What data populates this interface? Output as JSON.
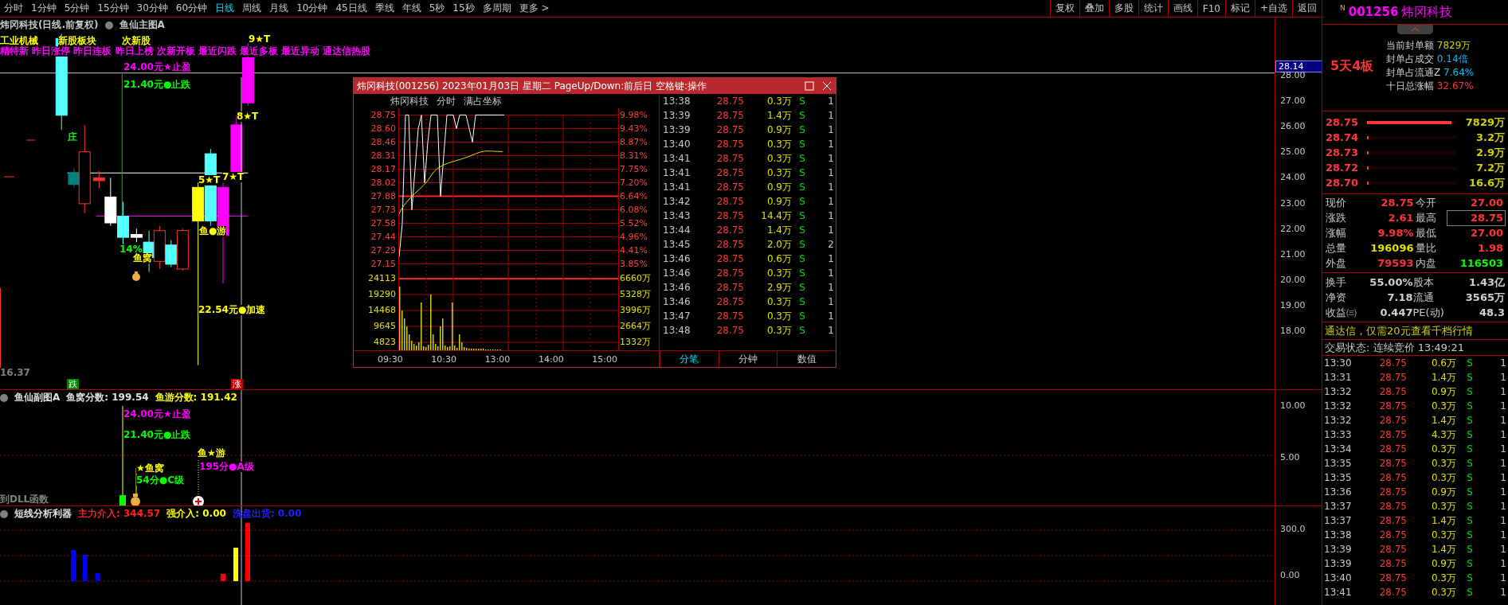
{
  "toolbar": {
    "periods": [
      {
        "label": "分时",
        "selected": false
      },
      {
        "label": "1分钟",
        "selected": false
      },
      {
        "label": "5分钟",
        "selected": false
      },
      {
        "label": "15分钟",
        "selected": false
      },
      {
        "label": "30分钟",
        "selected": false
      },
      {
        "label": "60分钟",
        "selected": false
      },
      {
        "label": "日线",
        "selected": true
      },
      {
        "label": "周线",
        "selected": false
      },
      {
        "label": "月线",
        "selected": false
      },
      {
        "label": "10分钟",
        "selected": false
      },
      {
        "label": "45日线",
        "selected": false
      },
      {
        "label": "季线",
        "selected": false
      },
      {
        "label": "年线",
        "selected": false
      },
      {
        "label": "5秒",
        "selected": false
      },
      {
        "label": "15秒",
        "selected": false
      },
      {
        "label": "多周期",
        "selected": false
      },
      {
        "label": "更多 >",
        "selected": false
      }
    ],
    "actions": [
      "复权",
      "叠加",
      "多股",
      "统计",
      "画线",
      "F10",
      "标记",
      "+自选",
      "返回"
    ]
  },
  "main_chart": {
    "title": "炜冈科技(日线.前复权)",
    "indicator": "鱼仙主图A",
    "labels": [
      {
        "text": "工业机械",
        "color": "#ffff00"
      },
      {
        "text": "新股板块",
        "color": "#ffff00"
      },
      {
        "text": "次新股",
        "color": "#ffff00"
      },
      {
        "text": "精特新 昨日涨停 昨日连板 昨日上榜 次新开板 最近闪跌 最近多板 最近异动 通达信热股",
        "color": "#ff00ff"
      },
      {
        "text": "9★T",
        "color": "#ffff00"
      },
      {
        "text": "24.00元★止盈",
        "color": "#ff00ff"
      },
      {
        "text": "21.40元●止跌",
        "color": "#00ff00"
      },
      {
        "text": "8★T",
        "color": "#ffff00"
      },
      {
        "text": "5★T",
        "color": "#ffff00"
      },
      {
        "text": "7★T",
        "color": "#ffff00"
      },
      {
        "text": "庄",
        "color": "#00ff00"
      },
      {
        "text": "14%",
        "color": "#00ff00"
      },
      {
        "text": "鱼窝",
        "color": "#ffff00"
      },
      {
        "text": "鱼●游",
        "color": "#ffff00"
      },
      {
        "text": "22.54元●加速",
        "color": "#ffff00"
      },
      {
        "text": "16.37",
        "color": "#808080"
      }
    ],
    "markers": [
      {
        "text": "跌",
        "color": "#008000"
      },
      {
        "text": "涨",
        "color": "#c00000"
      }
    ],
    "axis": [
      "28.00",
      "27.00",
      "26.00",
      "25.00",
      "24.00",
      "23.00",
      "22.00",
      "21.00",
      "20.00",
      "19.00",
      "18.00"
    ],
    "current_price": "28.14"
  },
  "sub_chart": {
    "readings": [
      {
        "text": "鱼仙副图A",
        "color": "#e0e0e0"
      },
      {
        "text": "鱼窝分数: 199.54",
        "color": "#e0e0e0"
      },
      {
        "text": "鱼游分数: 191.42",
        "color": "#ffff00"
      }
    ],
    "labels": [
      {
        "text": "24.00元★止盈",
        "color": "#ff00ff"
      },
      {
        "text": "21.40元●止跌",
        "color": "#00ff00"
      },
      {
        "text": "★鱼窝",
        "color": "#ffff00"
      },
      {
        "text": "54分●C级",
        "color": "#00ff00"
      },
      {
        "text": "鱼★游",
        "color": "#ffff00"
      },
      {
        "text": "195分●A级",
        "color": "#ff00ff"
      },
      {
        "text": "到DLL函数",
        "color": "#808080"
      }
    ],
    "axis": [
      "10.00",
      "5.00"
    ]
  },
  "bottom_chart": {
    "readings": [
      {
        "text": "短线分析利器",
        "color": "#e0e0e0"
      },
      {
        "text": "主力介入: 344.57",
        "color": "#ff2020"
      },
      {
        "text": "强介入: 0.00",
        "color": "#ffff00"
      },
      {
        "text": "洗盘出货: 0.00",
        "color": "#2020ff"
      }
    ],
    "axis": [
      "300.0",
      "0.00"
    ]
  },
  "popup": {
    "title": "炜冈科技(001256) 2023年01月03日 星期二 PageUp/Down:前后日 空格键:操作",
    "header": [
      "炜冈科技",
      "分时",
      "满占坐标"
    ],
    "prices": [
      "28.75",
      "28.60",
      "28.46",
      "28.31",
      "28.17",
      "28.02",
      "27.88",
      "27.73",
      "27.58",
      "27.44",
      "27.29",
      "27.15"
    ],
    "percents": [
      "9.98%",
      "9.43%",
      "8.87%",
      "8.31%",
      "7.75%",
      "7.20%",
      "6.64%",
      "6.08%",
      "5.52%",
      "4.96%",
      "4.41%",
      "3.85%"
    ],
    "volumes": [
      "24113",
      "19290",
      "14468",
      "9645",
      "4823"
    ],
    "amounts": [
      "6660万",
      "5328万",
      "3996万",
      "2664万",
      "1332万"
    ],
    "times": [
      "09:30",
      "10:30",
      "13:00",
      "14:00",
      "15:00"
    ],
    "ticks": [
      {
        "time": "13:38",
        "price": "28.75",
        "volume": "0.3万",
        "side": "S",
        "count": "1"
      },
      {
        "time": "13:39",
        "price": "28.75",
        "volume": "1.4万",
        "side": "S",
        "count": "1"
      },
      {
        "time": "13:39",
        "price": "28.75",
        "volume": "0.9万",
        "side": "S",
        "count": "1"
      },
      {
        "time": "13:40",
        "price": "28.75",
        "volume": "0.3万",
        "side": "S",
        "count": "1"
      },
      {
        "time": "13:41",
        "price": "28.75",
        "volume": "0.3万",
        "side": "S",
        "count": "1"
      },
      {
        "time": "13:41",
        "price": "28.75",
        "volume": "0.3万",
        "side": "S",
        "count": "1"
      },
      {
        "time": "13:41",
        "price": "28.75",
        "volume": "0.9万",
        "side": "S",
        "count": "1"
      },
      {
        "time": "13:42",
        "price": "28.75",
        "volume": "0.9万",
        "side": "S",
        "count": "1"
      },
      {
        "time": "13:43",
        "price": "28.75",
        "volume": "14.4万",
        "side": "S",
        "count": "1"
      },
      {
        "time": "13:44",
        "price": "28.75",
        "volume": "1.4万",
        "side": "S",
        "count": "1"
      },
      {
        "time": "13:45",
        "price": "28.75",
        "volume": "2.0万",
        "side": "S",
        "count": "2"
      },
      {
        "time": "13:46",
        "price": "28.75",
        "volume": "0.6万",
        "side": "S",
        "count": "1"
      },
      {
        "time": "13:46",
        "price": "28.75",
        "volume": "0.3万",
        "side": "S",
        "count": "1"
      },
      {
        "time": "13:46",
        "price": "28.75",
        "volume": "2.9万",
        "side": "S",
        "count": "1"
      },
      {
        "time": "13:46",
        "price": "28.75",
        "volume": "0.3万",
        "side": "S",
        "count": "1"
      },
      {
        "time": "13:47",
        "price": "28.75",
        "volume": "0.3万",
        "side": "S",
        "count": "1"
      },
      {
        "time": "13:48",
        "price": "28.75",
        "volume": "0.3万",
        "side": "S",
        "count": "1"
      }
    ],
    "tabs": [
      {
        "label": "分笔",
        "selected": true
      },
      {
        "label": "分钟",
        "selected": false
      },
      {
        "label": "数值",
        "selected": false
      }
    ]
  },
  "quote_panel": {
    "badge": "N",
    "code": "001256",
    "name": "炜冈科技",
    "board": "5天4板",
    "seal_info": [
      {
        "label": "当前封单额",
        "value": "7829万",
        "color": "#d0d000"
      },
      {
        "label": "封单占成交",
        "value": "0.14倍",
        "color": "#00c0ff"
      },
      {
        "label": "封单占流通Z",
        "value": "7.64%",
        "color": "#00c0ff"
      },
      {
        "label": "十日总涨幅",
        "value": "32.67%",
        "color": "#ff3333"
      }
    ],
    "order_book": [
      {
        "price": "28.75",
        "volume": "7829万",
        "level": 0.95
      },
      {
        "price": "28.74",
        "volume": "3.2万",
        "level": 0.02
      },
      {
        "price": "28.73",
        "volume": "2.9万",
        "level": 0.02
      },
      {
        "price": "28.72",
        "volume": "7.2万",
        "level": 0.02
      },
      {
        "price": "28.70",
        "volume": "16.6万",
        "level": 0.02
      }
    ],
    "quote": [
      {
        "label": "现价",
        "value": "28.75",
        "color": "#ff3333",
        "framed": false
      },
      {
        "label": "今开",
        "value": "27.00",
        "color": "#ff3333",
        "framed": false
      },
      {
        "label": "涨跌",
        "value": "2.61",
        "color": "#ff3333",
        "framed": false
      },
      {
        "label": "最高",
        "value": "28.75",
        "color": "#ff3333",
        "framed": true
      },
      {
        "label": "涨幅",
        "value": "9.98%",
        "color": "#ff3333",
        "framed": false
      },
      {
        "label": "最低",
        "value": "27.00",
        "color": "#ff3333",
        "framed": false
      },
      {
        "label": "总量",
        "value": "196096",
        "color": "#e0e000",
        "framed": false
      },
      {
        "label": "量比",
        "value": "1.98",
        "color": "#ff3333",
        "framed": false
      },
      {
        "label": "外盘",
        "value": "79593",
        "color": "#ff3333",
        "framed": false
      },
      {
        "label": "内盘",
        "value": "116503",
        "color": "#00ff00",
        "framed": false
      }
    ],
    "fundamentals": [
      {
        "label": "换手",
        "value": "55.00%"
      },
      {
        "label": "股本",
        "value": "1.43亿"
      },
      {
        "label": "净资",
        "value": "7.18"
      },
      {
        "label": "流通",
        "value": "3565万"
      },
      {
        "label": "收益㈢",
        "value": "0.447"
      },
      {
        "label": "PE(动)",
        "value": "48.3"
      }
    ],
    "banner": "通达信，仅需20元查看千档行情",
    "status": "交易状态: 连续竞价 13:49:21",
    "ticks": [
      {
        "time": "13:30",
        "price": "28.75",
        "volume": "0.6万",
        "side": "S",
        "count": "1"
      },
      {
        "time": "13:31",
        "price": "28.75",
        "volume": "1.4万",
        "side": "S",
        "count": "1"
      },
      {
        "time": "13:32",
        "price": "28.75",
        "volume": "0.9万",
        "side": "S",
        "count": "1"
      },
      {
        "time": "13:32",
        "price": "28.75",
        "volume": "0.3万",
        "side": "S",
        "count": "1"
      },
      {
        "time": "13:32",
        "price": "28.75",
        "volume": "1.4万",
        "side": "S",
        "count": "1"
      },
      {
        "time": "13:33",
        "price": "28.75",
        "volume": "4.3万",
        "side": "S",
        "count": "1"
      },
      {
        "time": "13:34",
        "price": "28.75",
        "volume": "0.3万",
        "side": "S",
        "count": "1"
      },
      {
        "time": "13:35",
        "price": "28.75",
        "volume": "0.3万",
        "side": "S",
        "count": "1"
      },
      {
        "time": "13:35",
        "price": "28.75",
        "volume": "0.3万",
        "side": "S",
        "count": "1"
      },
      {
        "time": "13:36",
        "price": "28.75",
        "volume": "0.9万",
        "side": "S",
        "count": "1"
      },
      {
        "time": "13:37",
        "price": "28.75",
        "volume": "0.3万",
        "side": "S",
        "count": "1"
      },
      {
        "time": "13:37",
        "price": "28.75",
        "volume": "1.4万",
        "side": "S",
        "count": "1"
      },
      {
        "time": "13:38",
        "price": "28.75",
        "volume": "0.3万",
        "side": "S",
        "count": "1"
      },
      {
        "time": "13:39",
        "price": "28.75",
        "volume": "1.4万",
        "side": "S",
        "count": "1"
      },
      {
        "time": "13:39",
        "price": "28.75",
        "volume": "0.9万",
        "side": "S",
        "count": "1"
      },
      {
        "time": "13:40",
        "price": "28.75",
        "volume": "0.3万",
        "side": "S",
        "count": "1"
      },
      {
        "time": "13:41",
        "price": "28.75",
        "volume": "0.3万",
        "side": "S",
        "count": "1"
      }
    ]
  }
}
